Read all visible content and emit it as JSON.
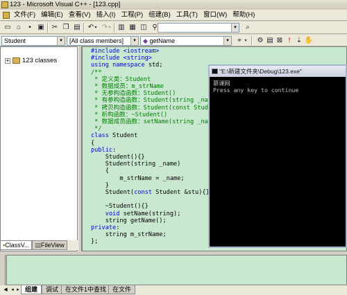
{
  "window": {
    "title": "123 - Microsoft Visual C++ - [123.cpp]"
  },
  "menu": {
    "items": [
      "文件(F)",
      "编辑(E)",
      "查看(V)",
      "插入(I)",
      "工程(P)",
      "组建(B)",
      "工具(T)",
      "窗口(W)",
      "帮助(H)"
    ]
  },
  "toolbar2": {
    "class_combo": "Student",
    "members_combo": "[All class members]",
    "function_combo": "getName"
  },
  "left_panel": {
    "tree_root": "123 classes",
    "tabs": [
      "ClassV...",
      "FileView"
    ]
  },
  "editor": {
    "lines": [
      [
        {
          "t": "#include <iostream>",
          "c": "pp"
        }
      ],
      [
        {
          "t": "#include <string>",
          "c": "pp"
        }
      ],
      [
        {
          "t": "using",
          "c": "kw"
        },
        {
          "t": " "
        },
        {
          "t": "namespace",
          "c": "kw"
        },
        {
          "t": " std;"
        }
      ],
      [
        {
          "t": "/**",
          "c": "cm"
        }
      ],
      [
        {
          "t": " * 定义类：Student",
          "c": "cm"
        }
      ],
      [
        {
          "t": " * 数据成员：m_strName",
          "c": "cm"
        }
      ],
      [
        {
          "t": " * 无参构造函数：Student()",
          "c": "cm"
        }
      ],
      [
        {
          "t": " * 有参构造函数：Student(string _nam",
          "c": "cm"
        }
      ],
      [
        {
          "t": " * 拷贝构造函数：Student(const Stude",
          "c": "cm"
        }
      ],
      [
        {
          "t": " * 析构函数：~Student()",
          "c": "cm"
        }
      ],
      [
        {
          "t": " * 数据成员函数：setName(string _nam",
          "c": "cm"
        }
      ],
      [
        {
          "t": " */",
          "c": "cm"
        }
      ],
      [
        {
          "t": "class",
          "c": "kw"
        },
        {
          "t": " Student"
        }
      ],
      [
        {
          "t": "{"
        }
      ],
      [
        {
          "t": "public",
          "c": "kw"
        },
        {
          "t": ":"
        }
      ],
      [
        {
          "t": "    Student(){}"
        }
      ],
      [
        {
          "t": "    Student(string _name)"
        }
      ],
      [
        {
          "t": "    {"
        }
      ],
      [
        {
          "t": "        m_strName = _name;"
        }
      ],
      [
        {
          "t": "    }"
        }
      ],
      [
        {
          "t": "    Student("
        },
        {
          "t": "const",
          "c": "kw"
        },
        {
          "t": " Student &stu){}"
        }
      ],
      [
        {
          "t": ""
        }
      ],
      [
        {
          "t": "    ~Student(){}"
        }
      ],
      [
        {
          "t": "    "
        },
        {
          "t": "void",
          "c": "kw"
        },
        {
          "t": " setName(string);"
        }
      ],
      [
        {
          "t": "    string getName();"
        }
      ],
      [
        {
          "t": "private",
          "c": "kw"
        },
        {
          "t": ":"
        }
      ],
      [
        {
          "t": "    string m_strName;"
        }
      ],
      [
        {
          "t": "};"
        }
      ]
    ]
  },
  "console": {
    "title": "\"E:\\新建文件夹\\Debug\\123.exe\"",
    "lines": [
      "慕课网",
      "Press any key to continue"
    ]
  },
  "bottom_tabs": [
    "组建",
    "调试",
    "在文件1中查找",
    "在文件"
  ]
}
